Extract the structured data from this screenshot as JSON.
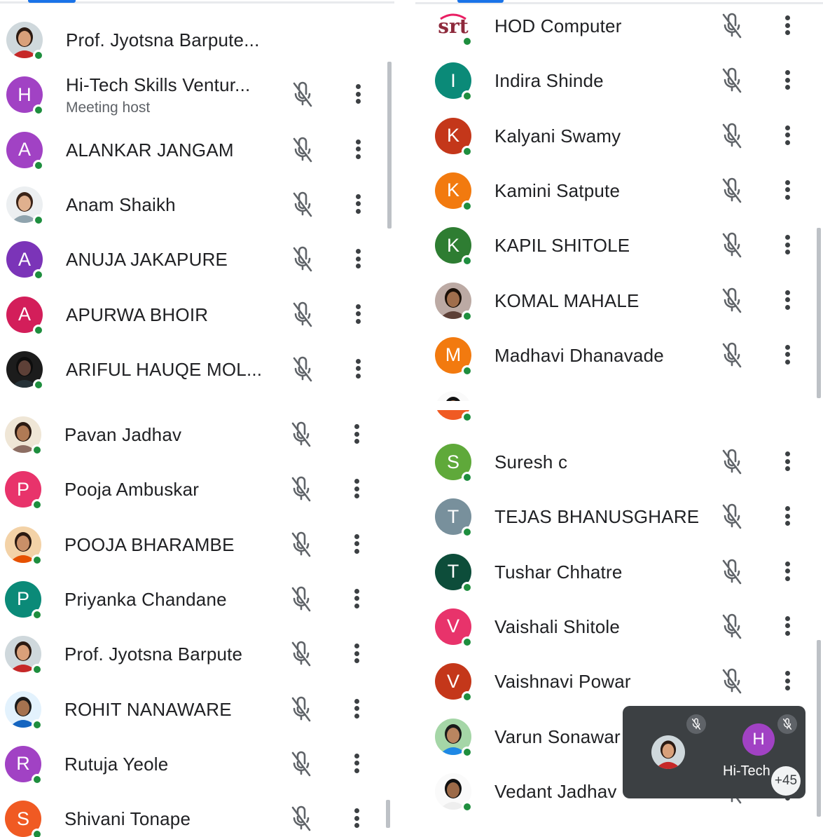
{
  "colors": {
    "online_dot": "#1e8e3e",
    "muted_icon": "#5f6368",
    "tab_accent": "#1a73e8",
    "pip_background": "#3c4043"
  },
  "left_top": {
    "participants": [
      {
        "name": "Prof. Jyotsna Barpute...",
        "avatar": "photo",
        "photo": "woman-red"
      },
      {
        "name": "Hi-Tech Skills Ventur...",
        "subtitle": "Meeting host",
        "avatar": "H",
        "color": "#a142c4"
      },
      {
        "name": "ALANKAR JANGAM",
        "avatar": "A",
        "color": "#a142c4"
      },
      {
        "name": "Anam Shaikh",
        "avatar": "photo",
        "photo": "woman-light"
      },
      {
        "name": "ANUJA JAKAPURE",
        "avatar": "A",
        "color": "#7b34b8"
      },
      {
        "name": "APURWA BHOIR",
        "avatar": "A",
        "color": "#d31e5a"
      },
      {
        "name": "ARIFUL HAUQE MOL...",
        "avatar": "photo",
        "photo": "dark"
      }
    ]
  },
  "left_bottom": {
    "participants": [
      {
        "name": "Pavan Jadhav",
        "avatar": "photo",
        "photo": "man-beige"
      },
      {
        "name": "Pooja Ambuskar",
        "avatar": "P",
        "color": "#e8336b"
      },
      {
        "name": "POOJA BHARAMBE",
        "avatar": "photo",
        "photo": "woman-orange"
      },
      {
        "name": "Priyanka Chandane",
        "avatar": "P",
        "color": "#0b8a78"
      },
      {
        "name": "Prof. Jyotsna Barpute",
        "avatar": "photo",
        "photo": "woman-red"
      },
      {
        "name": "ROHIT NANAWARE",
        "avatar": "photo",
        "photo": "man-blue"
      },
      {
        "name": "Rutuja Yeole",
        "avatar": "R",
        "color": "#a142c4"
      },
      {
        "name": "Shivani Tonape",
        "avatar": "S",
        "color": "#f05a23"
      }
    ]
  },
  "right_top": {
    "participants": [
      {
        "name": "HOD Computer",
        "avatar": "logo",
        "logo_text": "srt"
      },
      {
        "name": "Indira Shinde",
        "avatar": "I",
        "color": "#0b8a78"
      },
      {
        "name": "Kalyani Swamy",
        "avatar": "K",
        "color": "#c4371a"
      },
      {
        "name": "Kamini Satpute",
        "avatar": "K",
        "color": "#f27a0f"
      },
      {
        "name": "KAPIL SHITOLE",
        "avatar": "K",
        "color": "#2e7d32"
      },
      {
        "name": "KOMAL MAHALE",
        "avatar": "photo",
        "photo": "woman-dark"
      },
      {
        "name": "Madhavi Dhanavade",
        "avatar": "M",
        "color": "#f27a0f"
      }
    ]
  },
  "right_bottom": {
    "participants": [
      {
        "name": "Suresh c",
        "avatar": "S",
        "color": "#5fa93a"
      },
      {
        "name": "TEJAS BHANUSGHARE",
        "avatar": "T",
        "color": "#78909c"
      },
      {
        "name": "Tushar Chhatre",
        "avatar": "T",
        "color": "#0d4d3a"
      },
      {
        "name": "Vaishali Shitole",
        "avatar": "V",
        "color": "#e8336b"
      },
      {
        "name": "Vaishnavi Powar",
        "avatar": "V",
        "color": "#c4371a"
      },
      {
        "name": "Varun Sonawar",
        "avatar": "photo",
        "photo": "group"
      },
      {
        "name": "Vedant Jadhav",
        "avatar": "photo",
        "photo": "man-white"
      }
    ]
  },
  "pip": {
    "tile_name": "Hi-Tech",
    "tile_initial": "H",
    "tile_color": "#a142c4",
    "more_count": "+45"
  },
  "icons": {
    "mic_muted": "mic-off-icon",
    "more": "more-vert-icon",
    "status": "online-dot"
  }
}
